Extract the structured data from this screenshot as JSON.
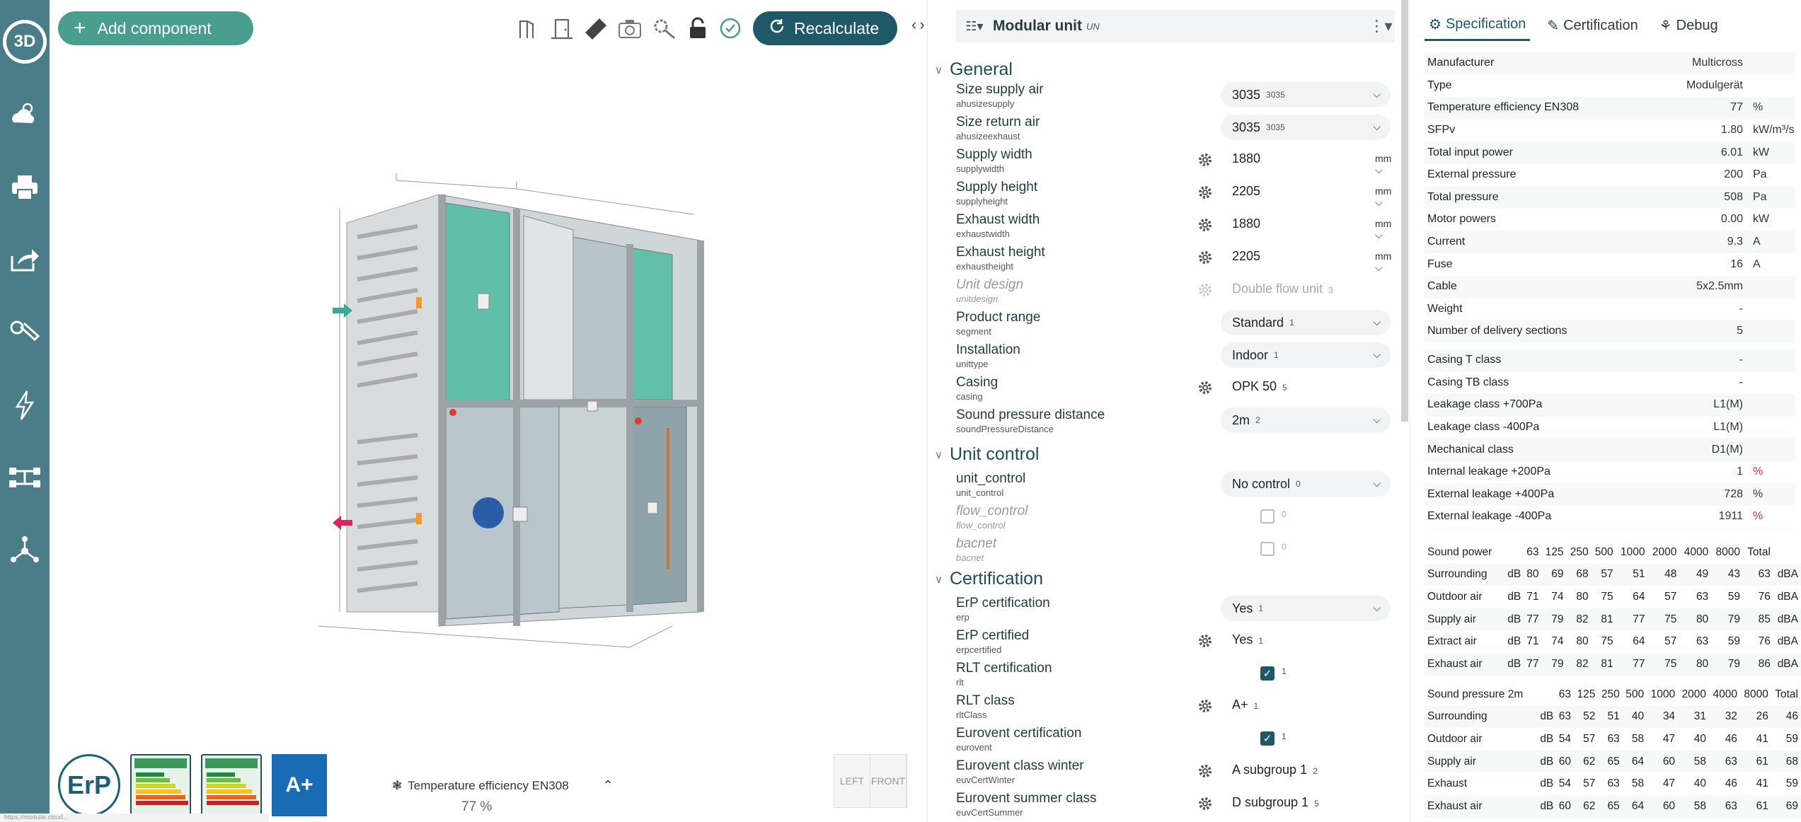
{
  "rail": {
    "logo": "3D",
    "items": [
      "weather-icon",
      "print-icon",
      "share-icon",
      "tools-icon",
      "electrical-icon",
      "controls-icon",
      "network-icon"
    ]
  },
  "viewer": {
    "add_component": "Add component",
    "recalculate": "Recalculate",
    "footer_metric_label": "Temperature efficiency EN308",
    "footer_metric_value": "77 %",
    "view_left": "LEFT",
    "view_front": "FRONT",
    "badge_erp": "ErP",
    "badge_energy": "A+",
    "status_url": "https://modular.cloud..."
  },
  "form": {
    "title": "Modular unit",
    "title_sub": "UN",
    "sections": {
      "general": "General",
      "unit_control": "Unit control",
      "certification": "Certification"
    },
    "general": [
      {
        "label": "Size supply air",
        "key": "ahusizesupply",
        "value": "3035",
        "sub": "3035"
      },
      {
        "label": "Size return air",
        "key": "ahusizeexhaust",
        "value": "3035",
        "sub": "3035"
      },
      {
        "label": "Supply width",
        "key": "supplywidth",
        "value": "1880",
        "unit": "mm"
      },
      {
        "label": "Supply height",
        "key": "supplyheight",
        "value": "2205",
        "unit": "mm"
      },
      {
        "label": "Exhaust width",
        "key": "exhaustwidth",
        "value": "1880",
        "unit": "mm"
      },
      {
        "label": "Exhaust height",
        "key": "exhaustheight",
        "value": "2205",
        "unit": "mm"
      },
      {
        "label": "Unit design",
        "key": "unitdesign",
        "value": "Double flow unit",
        "sub": "3"
      },
      {
        "label": "Product range",
        "key": "segment",
        "value": "Standard",
        "sub": "1"
      },
      {
        "label": "Installation",
        "key": "unittype",
        "value": "Indoor",
        "sub": "1"
      },
      {
        "label": "Casing",
        "key": "casing",
        "value": "OPK 50",
        "sub": "5"
      },
      {
        "label": "Sound pressure distance",
        "key": "soundPressureDistance",
        "value": "2m",
        "sub": "2"
      }
    ],
    "unit_control": [
      {
        "label": "unit_control",
        "key": "unit_control",
        "value": "No control",
        "sub": "0"
      },
      {
        "label": "flow_control",
        "key": "flow_control",
        "sub": "0"
      },
      {
        "label": "bacnet",
        "key": "bacnet",
        "sub": "0"
      }
    ],
    "certification": [
      {
        "label": "ErP certification",
        "key": "erp",
        "value": "Yes",
        "sub": "1"
      },
      {
        "label": "ErP certified",
        "key": "erpcertified",
        "value": "Yes",
        "sub": "1"
      },
      {
        "label": "RLT certification",
        "key": "rlt",
        "sub": "1"
      },
      {
        "label": "RLT class",
        "key": "rltClass",
        "value": "A+",
        "sub": "1"
      },
      {
        "label": "Eurovent certification",
        "key": "eurovent",
        "sub": "1"
      },
      {
        "label": "Eurovent class winter",
        "key": "euvCertWinter",
        "value": "A subgroup 1",
        "sub": "2"
      },
      {
        "label": "Eurovent summer class",
        "key": "euvCertSummer",
        "value": "D subgroup 1",
        "sub": "5"
      }
    ]
  },
  "spec": {
    "tabs": [
      "Specification",
      "Certification",
      "Debug"
    ],
    "rows": [
      {
        "k": "Manufacturer",
        "v": "Multicross",
        "u": ""
      },
      {
        "k": "Type",
        "v": "Modulgerät",
        "u": ""
      },
      {
        "k": "Temperature efficiency EN308",
        "v": "77",
        "u": "%"
      },
      {
        "k": "SFPv",
        "v": "1.80",
        "u": "kW/m³/s"
      },
      {
        "k": "Total input power",
        "v": "6.01",
        "u": "kW"
      },
      {
        "k": "External pressure",
        "v": "200",
        "u": "Pa"
      },
      {
        "k": "Total pressure",
        "v": "508",
        "u": "Pa"
      },
      {
        "k": "Motor powers",
        "v": "0.00",
        "u": "kW"
      },
      {
        "k": "Current",
        "v": "9.3",
        "u": "A"
      },
      {
        "k": "Fuse",
        "v": "16",
        "u": "A"
      },
      {
        "k": "Cable",
        "v": "5x2.5mm",
        "u": ""
      },
      {
        "k": "Weight",
        "v": "-",
        "u": ""
      },
      {
        "k": "Number of delivery sections",
        "v": "5",
        "u": ""
      }
    ],
    "rows2": [
      {
        "k": "Casing T class",
        "v": "-",
        "u": ""
      },
      {
        "k": "Casing TB class",
        "v": "-",
        "u": ""
      },
      {
        "k": "Leakage class +700Pa",
        "v": "L1(M)",
        "u": ""
      },
      {
        "k": "Leakage class -400Pa",
        "v": "L1(M)",
        "u": ""
      },
      {
        "k": "Mechanical class",
        "v": "D1(M)",
        "u": ""
      },
      {
        "k": "Internal leakage +200Pa",
        "v": "1",
        "u": "%",
        "red": true
      },
      {
        "k": "External leakage +400Pa",
        "v": "728",
        "u": "%"
      },
      {
        "k": "External leakage -400Pa",
        "v": "1911",
        "u": "%",
        "red": true
      }
    ],
    "sound_power": {
      "header": [
        "Sound power",
        "",
        "63",
        "125",
        "250",
        "500",
        "1000",
        "2000",
        "4000",
        "8000",
        "Total",
        ""
      ],
      "rows": [
        [
          "Surrounding",
          "dB",
          "80",
          "69",
          "68",
          "57",
          "51",
          "48",
          "49",
          "43",
          "63",
          "dBA"
        ],
        [
          "Outdoor air",
          "dB",
          "71",
          "74",
          "80",
          "75",
          "64",
          "57",
          "63",
          "59",
          "76",
          "dBA"
        ],
        [
          "Supply air",
          "dB",
          "77",
          "79",
          "82",
          "81",
          "77",
          "75",
          "80",
          "79",
          "85",
          "dBA"
        ],
        [
          "Extract air",
          "dB",
          "71",
          "74",
          "80",
          "75",
          "64",
          "57",
          "63",
          "59",
          "76",
          "dBA"
        ],
        [
          "Exhaust air",
          "dB",
          "77",
          "79",
          "82",
          "81",
          "77",
          "75",
          "80",
          "79",
          "86",
          "dBA"
        ]
      ]
    },
    "sound_pressure": {
      "header": [
        "Sound pressure 2m",
        "",
        "63",
        "125",
        "250",
        "500",
        "1000",
        "2000",
        "4000",
        "8000",
        "Total"
      ],
      "rows": [
        [
          "Surrounding",
          "dB",
          "63",
          "52",
          "51",
          "40",
          "34",
          "31",
          "32",
          "26",
          "46"
        ],
        [
          "Outdoor air",
          "dB",
          "54",
          "57",
          "63",
          "58",
          "47",
          "40",
          "46",
          "41",
          "59"
        ],
        [
          "Supply air",
          "dB",
          "60",
          "62",
          "65",
          "64",
          "60",
          "58",
          "63",
          "61",
          "68"
        ],
        [
          "Exhaust",
          "dB",
          "54",
          "57",
          "63",
          "58",
          "47",
          "40",
          "46",
          "41",
          "59"
        ],
        [
          "Exhaust air",
          "dB",
          "60",
          "62",
          "65",
          "64",
          "60",
          "58",
          "63",
          "61",
          "69"
        ]
      ]
    }
  }
}
